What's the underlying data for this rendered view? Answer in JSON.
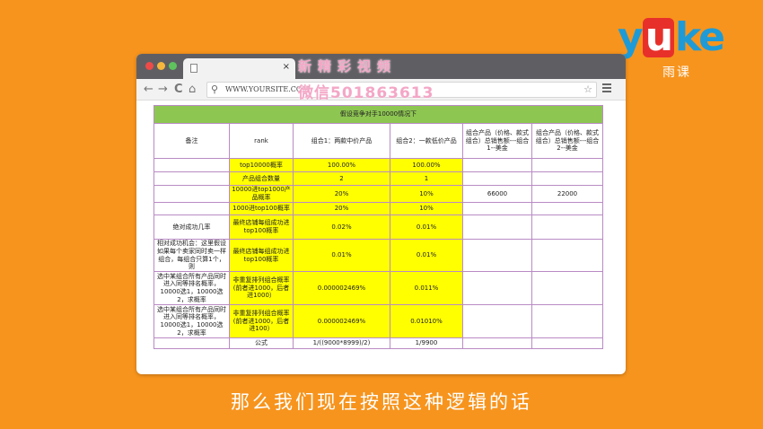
{
  "logo": {
    "wordmark_left": "y",
    "wordmark_mid": "u",
    "wordmark_right": "ke",
    "subtitle": "雨课"
  },
  "browser": {
    "tab_close": "×",
    "url": "WWW.YOURSITE.COM",
    "watermark_top": "新精彩视频",
    "watermark_mid": "微信501863613"
  },
  "sheet": {
    "title": "假设竞争对手10000情况下",
    "header": [
      "备注",
      "rank",
      "组合1：两款中价产品",
      "组合2：一款低价产品",
      "组合产品（价格、款式组合）总销售额---组合1--美金",
      "组合产品（价格、款式组合）总销售额---组合2--美金"
    ],
    "rows": [
      [
        "",
        "top10000概率",
        "100.00%",
        "100.00%",
        "",
        ""
      ],
      [
        "",
        "产品组合数量",
        "2",
        "1",
        "",
        ""
      ],
      [
        "",
        "10000进top1000产品概率",
        "20%",
        "10%",
        "66000",
        "22000"
      ],
      [
        "",
        "1000进top100概率",
        "20%",
        "10%",
        "",
        ""
      ],
      [
        "绝对成功几率",
        "最终店铺每组成功进top100概率",
        "0.02%",
        "0.01%",
        "",
        ""
      ],
      [
        "相对成功机会：这里假设如果每个卖家同时卖一样组合，每组合只算1个，则",
        "最终店铺每组成功进top100概率",
        "0.01%",
        "0.01%",
        "",
        ""
      ],
      [
        "选中某组合所有产品同时进入同等排名概率，10000选1，10000选2，求概率",
        "非重复排列组合概率(前者进1000，后者进1000）",
        "0.000002469%",
        "0.011%",
        "",
        ""
      ],
      [
        "选中某组合所有产品同时进入同等排名概率，10000选1，10000选2，求概率",
        "非重复排列组合概率(前者进1000，后者进100）",
        "0.000002469%",
        "0.01010%",
        "",
        ""
      ],
      [
        "",
        "公式",
        "1/((9000*8999)/2)",
        "1/9900",
        "",
        ""
      ]
    ]
  },
  "caption": "那么我们现在按照这种逻辑的话",
  "colors": {
    "background": "#f7941d",
    "table_title": "#8ec652",
    "highlight": "#ffff00",
    "grid": "#b98bc4"
  }
}
